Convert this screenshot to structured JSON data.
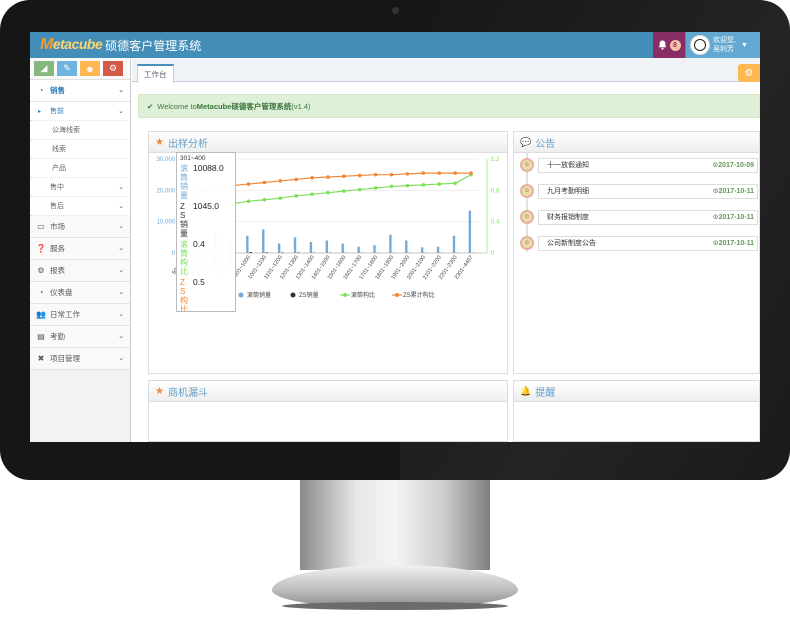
{
  "app": {
    "logo_initial": "M",
    "logo_rest": "etacube",
    "name": "硕德客户管理系统",
    "bell_count": "8",
    "welcome_line1": "欢迎您,",
    "welcome_line2": "吴利芳",
    "avatar_caption": "柔哥哥"
  },
  "sidebar": {
    "items": [
      {
        "label": "销售",
        "icon": "dashboard-icon"
      },
      {
        "label": "市场",
        "icon": "desktop-icon"
      },
      {
        "label": "服务",
        "icon": "question-icon"
      },
      {
        "label": "报表",
        "icon": "cogs-icon"
      },
      {
        "label": "仪表盘",
        "icon": "dashboard-icon"
      },
      {
        "label": "日常工作",
        "icon": "users-icon"
      },
      {
        "label": "考勤",
        "icon": "clipboard-icon"
      },
      {
        "label": "项目管理",
        "icon": "puzzle-icon"
      }
    ],
    "sales_sub": {
      "pre": "售前",
      "pre_items": [
        "公海线索",
        "线索",
        "产品"
      ],
      "mid": "售中",
      "post": "售后"
    }
  },
  "main": {
    "tab_label": "工作台",
    "welcome_prefix": "Welcome to ",
    "welcome_brand": "Metacube硕德客户管理系统",
    "welcome_version": " (v1.4)",
    "chart_widget_title": "出样分析",
    "notice_widget_title": "公告",
    "funnel_widget_title": "商机漏斗",
    "remind_widget_title": "提醒"
  },
  "notices": [
    {
      "title": "十一放假通知",
      "date": "2017-10-09"
    },
    {
      "title": "九月考勤明细",
      "date": "2017-10-11"
    },
    {
      "title": "财务报销制度",
      "date": "2017-10-11"
    },
    {
      "title": "公司新制度公告",
      "date": "2017-10-11"
    }
  ],
  "tooltip": {
    "header": "301~400",
    "rows": [
      {
        "key": "滚筒销量",
        "value": "10088.0",
        "color": "#74aad8"
      },
      {
        "key": "ZS销量",
        "value": "1045.0",
        "color": "#333333"
      },
      {
        "key": "滚筒构比",
        "value": "0.4",
        "color": "#7ee05a"
      },
      {
        "key": "ZS构比",
        "value": "0.5",
        "color": "#f0883a"
      }
    ]
  },
  "chart_data": {
    "type": "bar",
    "categories": [
      "501~600",
      "601~700",
      "701~800",
      "801~900",
      "901~1000",
      "1001~1100",
      "1101~1200",
      "1201~1300",
      "1301~1400",
      "1401~1500",
      "1501~1600",
      "1601~1700",
      "1701~1800",
      "1801~1900",
      "1901~2000",
      "2001~2100",
      "2101~2200",
      "2201~2300",
      "2301~4407"
    ],
    "ylim": [
      0,
      30000
    ],
    "y_ticks": [
      "30,000",
      "20,000",
      "10,000",
      "0"
    ],
    "y2lim": [
      0,
      1.2
    ],
    "y2_ticks": [
      "1.2",
      "0.8",
      "0.4",
      "0"
    ],
    "series": [
      {
        "name": "滚筒销量",
        "kind": "bar",
        "color": "#74aad8",
        "values": [
          9500,
          4500,
          7000,
          3500,
          5500,
          7500,
          3000,
          5000,
          3500,
          4000,
          3000,
          2000,
          2500,
          5800,
          4000,
          1800,
          2000,
          5500,
          13500
        ]
      },
      {
        "name": "ZS销量",
        "kind": "bar",
        "color": "#333333",
        "values": [
          500,
          400,
          300,
          250,
          300,
          200,
          150,
          150,
          100,
          100,
          80,
          80,
          70,
          60,
          50,
          50,
          40,
          40,
          30
        ]
      },
      {
        "name": "滚筒构比",
        "kind": "line",
        "color": "#7ee05a",
        "values": [
          0.5,
          0.57,
          0.6,
          0.63,
          0.66,
          0.68,
          0.7,
          0.73,
          0.75,
          0.77,
          0.79,
          0.81,
          0.83,
          0.85,
          0.86,
          0.87,
          0.88,
          0.89,
          1.0
        ]
      },
      {
        "name": "ZS累计构比",
        "kind": "line",
        "color": "#f0883a",
        "values": [
          0.75,
          0.8,
          0.84,
          0.86,
          0.88,
          0.9,
          0.92,
          0.94,
          0.96,
          0.97,
          0.98,
          0.99,
          1.0,
          1.0,
          1.01,
          1.02,
          1.02,
          1.02,
          1.02
        ]
      }
    ]
  }
}
